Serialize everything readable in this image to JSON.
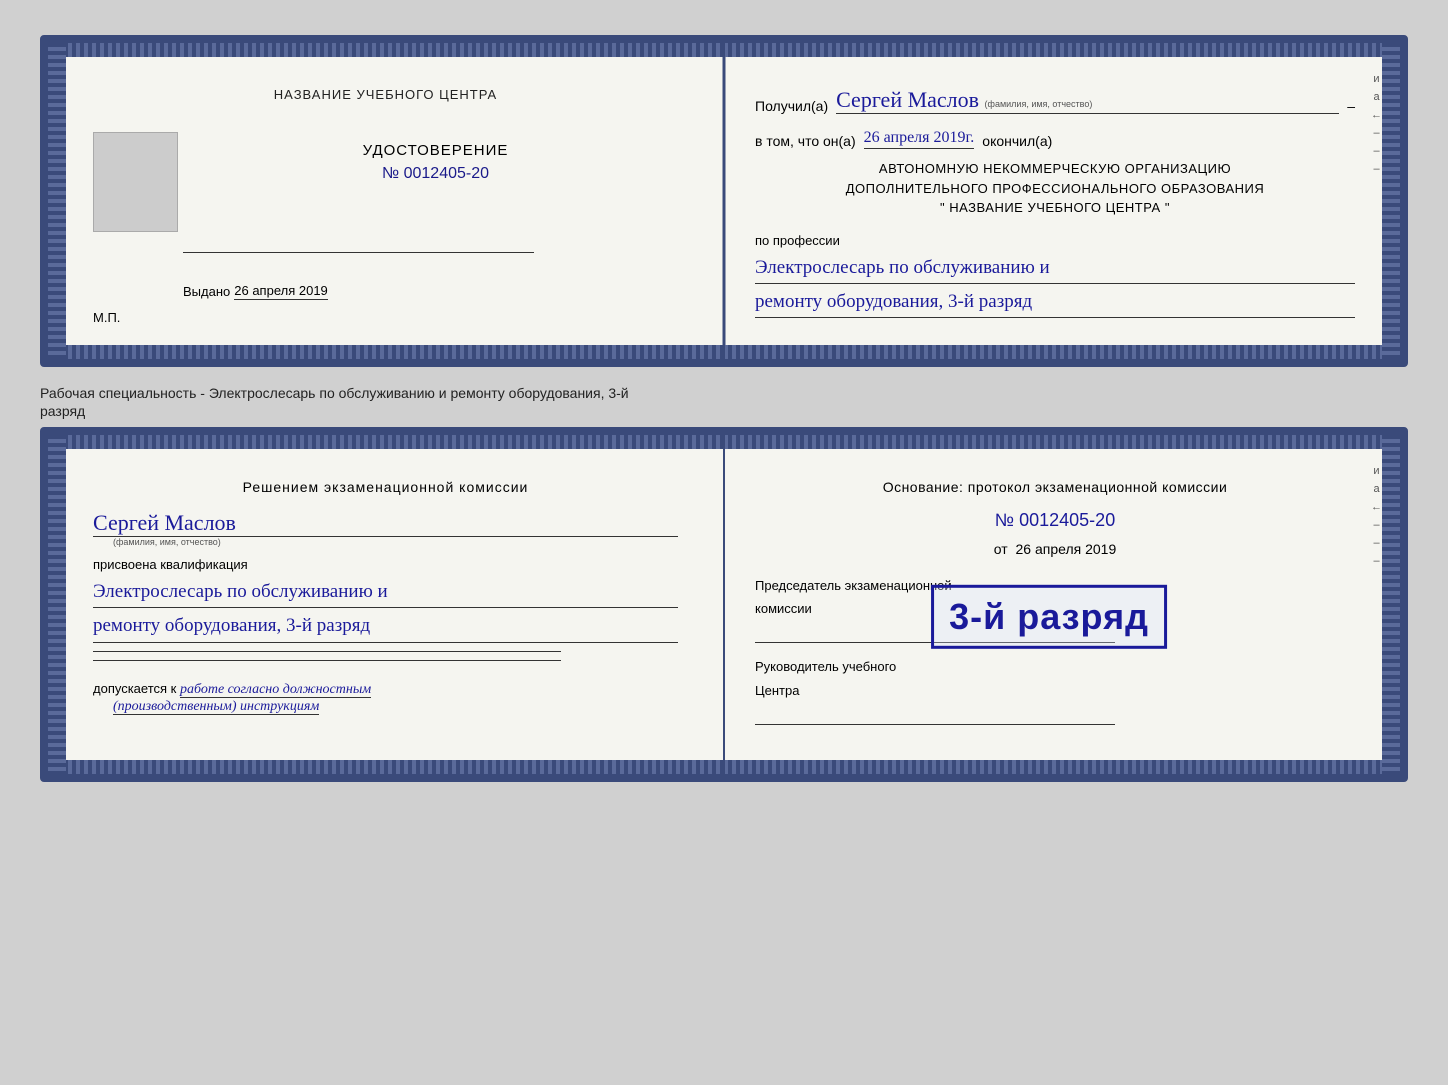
{
  "cert1": {
    "left": {
      "org_name": "НАЗВАНИЕ УЧЕБНОГО ЦЕНТРА",
      "doc_title": "УДОСТОВЕРЕНИЕ",
      "doc_number": "№ 0012405-20",
      "vydano_label": "Выдано",
      "vydano_date": "26 апреля 2019",
      "mp_label": "М.П."
    },
    "right": {
      "poluchil_label": "Получил(а)",
      "recipient_name": "Сергей Маслов",
      "fio_subtitle": "(фамилия, имя, отчество)",
      "dash": "–",
      "vtom_label": "в том, что он(а)",
      "vtom_date": "26 апреля 2019г.",
      "okonchil_label": "окончил(а)",
      "org_line1": "АВТОНОМНУЮ НЕКОММЕРЧЕСКУЮ ОРГАНИЗАЦИЮ",
      "org_line2": "ДОПОЛНИТЕЛЬНОГО ПРОФЕССИОНАЛЬНОГО ОБРАЗОВАНИЯ",
      "org_line3": "\"   НАЗВАНИЕ УЧЕБНОГО ЦЕНТРА   \"",
      "po_professii": "по профессии",
      "profession_line1": "Электрослесарь по обслуживанию и",
      "profession_line2": "ремонту оборудования, 3-й разряд"
    }
  },
  "specialty_text": "Рабочая специальность - Электрослесарь по обслуживанию и ремонту оборудования, 3-й",
  "specialty_text2": "разряд",
  "cert2": {
    "left": {
      "resheniem_title": "Решением экзаменационной комиссии",
      "name_handwritten": "Сергей Маслов",
      "fio_subtitle": "(фамилия, имя, отчество)",
      "prisvoena": "присвоена квалификация",
      "qualification_line1": "Электрослесарь по обслуживанию и",
      "qualification_line2": "ремонту оборудования, 3-й разряд",
      "dopuskaetsya_label": "допускается к",
      "dopuskaetsya_value": "работе согласно должностным",
      "dopuskaetsya_value2": "(производственным) инструкциям"
    },
    "right": {
      "osnovanie_label": "Основание: протокол экзаменационной комиссии",
      "protocol_number": "№  0012405-20",
      "ot_label": "от",
      "ot_date": "26 апреля 2019",
      "predsedatel_label": "Председатель экзаменационной",
      "komissii_label": "комиссии",
      "rukovoditel_label": "Руководитель учебного",
      "centra_label": "Центра"
    },
    "stamp": {
      "text": "3-й разряд"
    }
  },
  "right_deco": {
    "letters": [
      "и",
      "a",
      "←",
      "–",
      "–",
      "–"
    ]
  }
}
